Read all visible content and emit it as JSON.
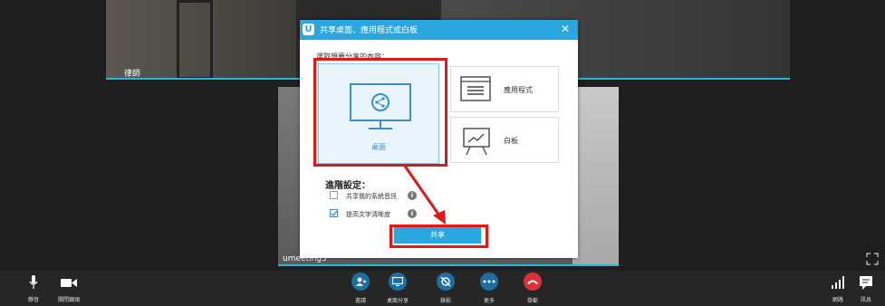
{
  "top_tile": {
    "label": "律師"
  },
  "bottom_tile": {
    "label": "umeeting3"
  },
  "dialog": {
    "logo": "U",
    "title": "共享桌面、應用程式或白板",
    "close": "✕",
    "prompt": "選取想要分享的內容：",
    "options": {
      "desktop": "桌面",
      "app": "應用程式",
      "whiteboard": "白板"
    },
    "advanced_title": "進階設定：",
    "checkbox_1": {
      "label": "共享我的系統音訊",
      "checked": false
    },
    "checkbox_2": {
      "label": "提高文字清晰度",
      "checked": true
    },
    "share_button": "共享"
  },
  "toolbar": {
    "mute": "靜音",
    "stop_video": "關閉鏡頭",
    "invite": "邀請",
    "share_screen": "桌面分享",
    "record": "錄影",
    "more": "更多",
    "hangup": "掛斷",
    "network": "網路",
    "chat": "訊息"
  },
  "colors": {
    "accent": "#29a8df",
    "annotation": "#e01818",
    "invite": "#1d6fa3",
    "hangup": "#d9323a",
    "toolbar_bg": "#262626"
  }
}
